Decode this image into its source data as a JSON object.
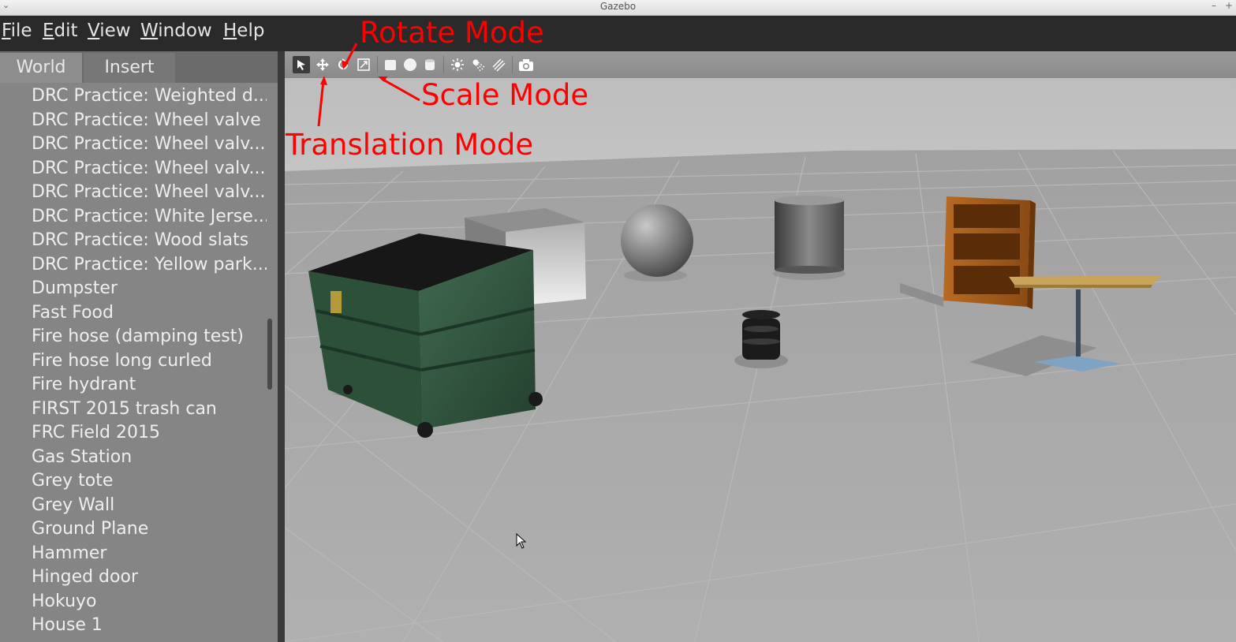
{
  "window": {
    "title": "Gazebo"
  },
  "menubar": {
    "items": [
      "File",
      "Edit",
      "View",
      "Window",
      "Help"
    ]
  },
  "sidebar": {
    "tabs": [
      {
        "label": "World",
        "active": false
      },
      {
        "label": "Insert",
        "active": true
      }
    ],
    "models": [
      "DRC Practice: Weighted d...",
      "DRC Practice: Wheel valve",
      "DRC Practice: Wheel valv...",
      "DRC Practice: Wheel valv...",
      "DRC Practice: Wheel valv...",
      "DRC Practice: White Jerse...",
      "DRC Practice: Wood slats",
      "DRC Practice: Yellow park...",
      "Dumpster",
      "Fast Food",
      "Fire hose (damping test)",
      "Fire hose long curled",
      "Fire hydrant",
      "FIRST 2015 trash can",
      "FRC Field 2015",
      "Gas Station",
      "Grey tote",
      "Grey Wall",
      "Ground Plane",
      "Hammer",
      "Hinged door",
      "Hokuyo",
      "House 1"
    ]
  },
  "toolbar": {
    "tools": [
      {
        "name": "select-mode",
        "icon": "cursor-icon",
        "active": true
      },
      {
        "name": "translate-mode",
        "icon": "move-arrows-icon",
        "active": false
      },
      {
        "name": "rotate-mode",
        "icon": "rotate-icon",
        "active": false
      },
      {
        "name": "scale-mode",
        "icon": "scale-icon",
        "active": false
      },
      {
        "name": "box-shape",
        "icon": "box-icon",
        "active": false
      },
      {
        "name": "sphere-shape",
        "icon": "sphere-icon",
        "active": false
      },
      {
        "name": "cylinder-shape",
        "icon": "cylinder-icon",
        "active": false
      },
      {
        "name": "point-light",
        "icon": "point-light-icon",
        "active": false
      },
      {
        "name": "spot-light",
        "icon": "spot-light-icon",
        "active": false
      },
      {
        "name": "directional-light",
        "icon": "directional-light-icon",
        "active": false
      },
      {
        "name": "screenshot",
        "icon": "camera-icon",
        "active": false
      }
    ]
  },
  "annotations": {
    "rotate": "Rotate Mode",
    "scale": "Scale Mode",
    "translate": "Translation Mode",
    "color": "#ff0000"
  },
  "colors": {
    "viewport_sky": "#bfbfbf",
    "ground": "#a8a8a8",
    "panel": "#858585",
    "menubar": "#2a2a2a"
  }
}
